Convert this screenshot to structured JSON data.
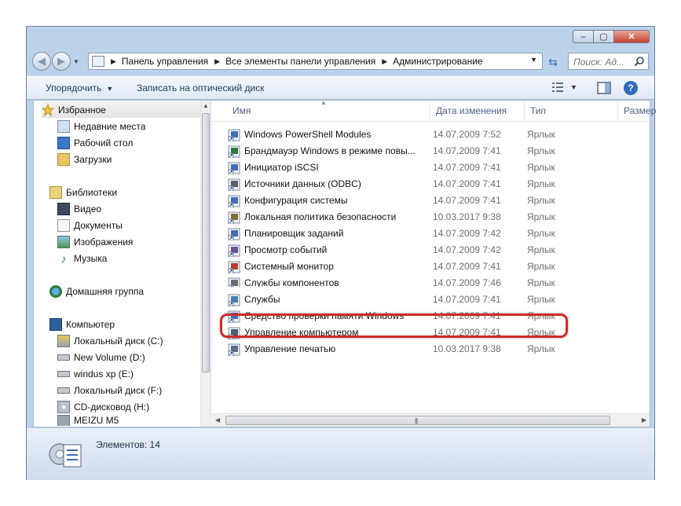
{
  "window": {
    "controls": {
      "minimize": "–",
      "maximize": "▢",
      "close": "✕"
    }
  },
  "address": {
    "crumbs": [
      "Панель управления",
      "Все элементы панели управления",
      "Администрирование"
    ],
    "search_placeholder": "Поиск: Ад..."
  },
  "toolbar": {
    "organize": "Упорядочить",
    "burn": "Записать на оптический диск"
  },
  "nav": {
    "favorites": "Избранное",
    "recent": "Недавние места",
    "desktop": "Рабочий стол",
    "downloads": "Загрузки",
    "libraries": "Библиотеки",
    "video": "Видео",
    "documents": "Документы",
    "images": "Изображения",
    "music": "Музыка",
    "homegroup": "Домашняя группа",
    "computer": "Компьютер",
    "disk_c": "Локальный диск (C:)",
    "disk_d": "New Volume (D:)",
    "disk_e": "windus xp (E:)",
    "disk_f": "Локальный диск (F:)",
    "disk_h": "CD-дисковод (H:)",
    "meizu": "MEIZU M5"
  },
  "columns": {
    "name": "Имя",
    "date": "Дата изменения",
    "type": "Тип",
    "size": "Размер"
  },
  "files": [
    {
      "name": "Windows PowerShell Modules",
      "date": "14.07.2009 7:52",
      "type": "Ярлык"
    },
    {
      "name": "Брандмауэр Windows в режиме повы...",
      "date": "14.07.2009 7:41",
      "type": "Ярлык"
    },
    {
      "name": "Инициатор iSCSI",
      "date": "14.07.2009 7:41",
      "type": "Ярлык"
    },
    {
      "name": "Источники данных (ODBC)",
      "date": "14.07.2009 7:41",
      "type": "Ярлык"
    },
    {
      "name": "Конфигурация системы",
      "date": "14.07.2009 7:41",
      "type": "Ярлык"
    },
    {
      "name": "Локальная политика безопасности",
      "date": "10.03.2017 9:38",
      "type": "Ярлык"
    },
    {
      "name": "Планировщик заданий",
      "date": "14.07.2009 7:42",
      "type": "Ярлык"
    },
    {
      "name": "Просмотр событий",
      "date": "14.07.2009 7:42",
      "type": "Ярлык"
    },
    {
      "name": "Системный монитор",
      "date": "14.07.2009 7:41",
      "type": "Ярлык"
    },
    {
      "name": "Службы компонентов",
      "date": "14.07.2009 7:46",
      "type": "Ярлык"
    },
    {
      "name": "Службы",
      "date": "14.07.2009 7:41",
      "type": "Ярлык"
    },
    {
      "name": "Средство проверки памяти Windows",
      "date": "14.07.2009 7:41",
      "type": "Ярлык"
    },
    {
      "name": "Управление компьютером",
      "date": "14.07.2009 7:41",
      "type": "Ярлык"
    },
    {
      "name": "Управление печатью",
      "date": "10.03.2017 9:38",
      "type": "Ярлык"
    }
  ],
  "status": {
    "count": "Элементов: 14"
  },
  "colors": {
    "highlight": "#cf2a2a",
    "frame": "#bcd1ea"
  }
}
